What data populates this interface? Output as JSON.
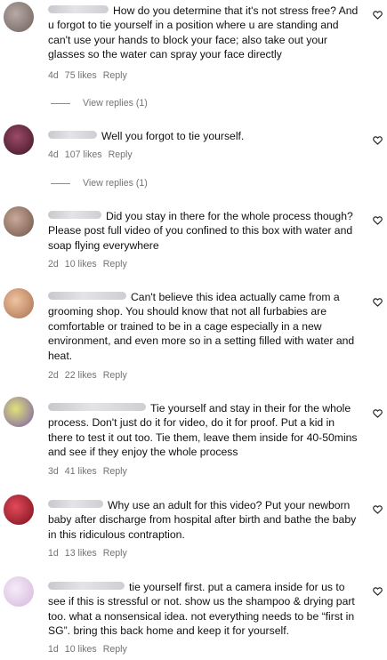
{
  "comments": [
    {
      "text": "How do you determine that it's not stress free? And u forgot to tie yourself in a position where u are standing and can't use your hands to block your face; also take out your glasses so the water can spray your face directly",
      "time": "4d",
      "likes": "75 likes",
      "reply": "Reply",
      "view_replies": "View replies (1)",
      "avatar_color": "#8a7a76"
    },
    {
      "text": "Well you forgot to tie yourself.",
      "time": "4d",
      "likes": "107 likes",
      "reply": "Reply",
      "view_replies": "View replies (1)",
      "avatar_color": "#6a2b43"
    },
    {
      "text": "Did you stay in there for the whole process though? Please post full video of you confined to this box with water and soap flying everywhere",
      "time": "2d",
      "likes": "10 likes",
      "reply": "Reply",
      "avatar_color": "#9a7c6e"
    },
    {
      "text": "Can't believe this idea actually came from a grooming shop. You should know that not all furbabies are comfortable or trained to be in a cage especially in a new environment, and even more so in a setting filled with water and heat.",
      "time": "2d",
      "likes": "22 likes",
      "reply": "Reply",
      "avatar_color": "#c79a74"
    },
    {
      "text": "Tie yourself and stay in their for the whole process. Don't just do it for video, do it for proof. Put a kid in there to test it out too. Tie them, leave them inside for 40-50mins and see if they enjoy the whole process",
      "time": "3d",
      "likes": "41 likes",
      "reply": "Reply",
      "avatar_color": "#b3b94a"
    },
    {
      "text": "Why use an adult for this video? Put your newborn baby after discharge from hospital after birth and bathe the baby in this ridiculous contraption.",
      "time": "1d",
      "likes": "13 likes",
      "reply": "Reply",
      "avatar_color": "#c4283a"
    },
    {
      "text": "tie yourself first. put a camera inside for us to see if this is stressful or not. show us the shampoo & drying part too. what a nonsensical idea. not everything needs to be “first in SG”. bring this back home and keep it for yourself.",
      "time": "1d",
      "likes": "10 likes",
      "reply": "Reply",
      "avatar_color": "#ead6ee"
    }
  ],
  "icons": {
    "like": "heart-outline-icon",
    "avatar": "profile-avatar-icon"
  }
}
